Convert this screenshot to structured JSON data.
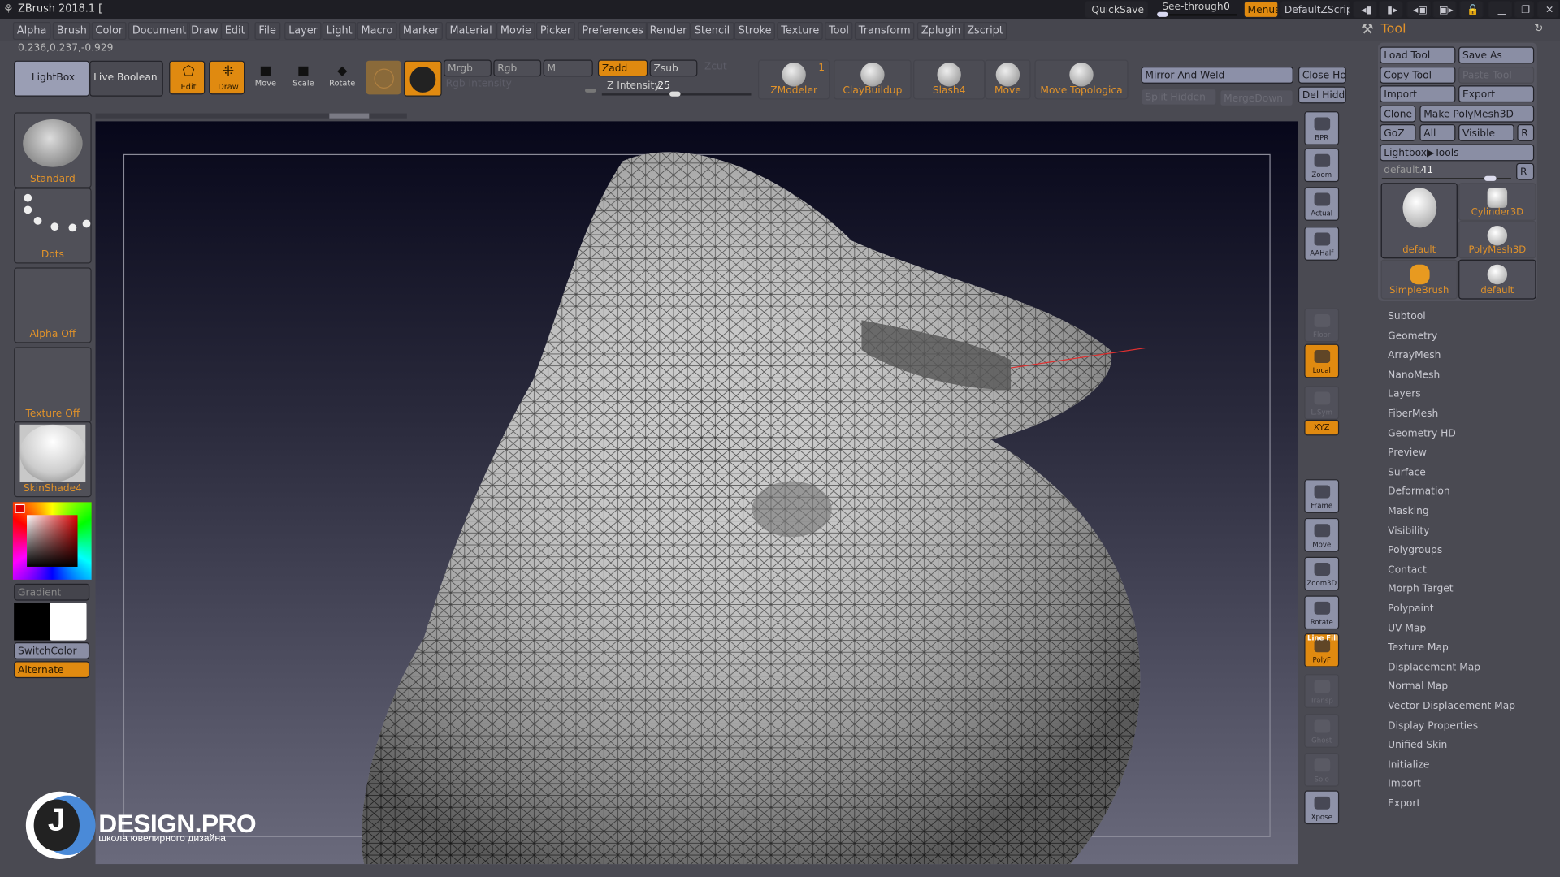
{
  "app": {
    "title": "ZBrush 2018.1 ["
  },
  "titlebar": {
    "quicksave": "QuickSave",
    "see_through_label": "See-through",
    "see_through_value": "0",
    "menus": "Menus",
    "script": "DefaultZScript"
  },
  "menu": [
    "Alpha",
    "Brush",
    "Color",
    "Document",
    "Draw",
    "Edit",
    "File",
    "Layer",
    "Light",
    "Macro",
    "Marker",
    "Material",
    "Movie",
    "Picker",
    "Preferences",
    "Render",
    "Stencil",
    "Stroke",
    "Texture",
    "Tool",
    "Transform",
    "Zplugin",
    "Zscript"
  ],
  "coords": "0.236,0.237,-0.929",
  "toolbar": {
    "lightbox": "LightBox",
    "live_boolean": "Live Boolean",
    "edit": "Edit",
    "draw": "Draw",
    "move": "Move",
    "scale": "Scale",
    "rotate": "Rotate",
    "mrgb": "Mrgb",
    "rgb": "Rgb",
    "m": "M",
    "rgb_intensity": "Rgb Intensity",
    "zadd": "Zadd",
    "zsub": "Zsub",
    "zcut": "Zcut",
    "z_intensity_label": "Z Intensity",
    "z_intensity_value": "25",
    "z_intensity_fraction": 0.25,
    "brushes": [
      {
        "label": "ZModeler",
        "badge": "1"
      },
      {
        "label": "ClayBuildup"
      },
      {
        "label": "Slash4"
      },
      {
        "label": "Move"
      },
      {
        "label": "Move Topologica"
      }
    ],
    "mirror_weld": "Mirror And Weld",
    "split_hidden": "Split Hidden",
    "merge_down": "MergeDown",
    "close_holes": "Close Hol",
    "del_hidden": "Del Hidde"
  },
  "left": {
    "brush": "Standard",
    "stroke": "Dots",
    "alpha": "Alpha Off",
    "texture": "Texture Off",
    "material": "SkinShade4",
    "gradient": "Gradient",
    "switch_color": "SwitchColor",
    "alternate": "Alternate",
    "main_color": "#000000",
    "secondary_color": "#ffffff"
  },
  "right_shelf": [
    {
      "label": "BPR",
      "state": "normal"
    },
    {
      "label": "Zoom",
      "state": "normal"
    },
    {
      "label": "Actual",
      "state": "normal"
    },
    {
      "label": "AAHalf",
      "state": "normal"
    },
    {
      "label": "Floor",
      "state": "off"
    },
    {
      "label": "Local",
      "state": "active"
    },
    {
      "label": "L.Sym",
      "state": "off"
    },
    {
      "label": "XYZ",
      "state": "active"
    },
    {
      "label": "Frame",
      "state": "normal"
    },
    {
      "label": "Move",
      "state": "normal"
    },
    {
      "label": "Zoom3D",
      "state": "normal"
    },
    {
      "label": "Rotate",
      "state": "normal"
    },
    {
      "label": "PolyF",
      "state": "active",
      "sub": "Line Fill"
    },
    {
      "label": "Transp",
      "state": "off"
    },
    {
      "label": "Ghost",
      "state": "off"
    },
    {
      "label": "Solo",
      "state": "off"
    },
    {
      "label": "Xpose",
      "state": "normal"
    }
  ],
  "tool": {
    "title": "Tool",
    "load_tool": "Load Tool",
    "save_as": "Save As",
    "copy_tool": "Copy Tool",
    "paste_tool": "Paste Tool",
    "import": "Import",
    "export": "Export",
    "clone": "Clone",
    "make_polymesh": "Make PolyMesh3D",
    "goz": "GoZ",
    "all": "All",
    "visible": "Visible",
    "r": "R",
    "lightbox_tools": "Lightbox▶Tools",
    "current_name": "default.",
    "current_value": "41",
    "thumbs": [
      "default",
      "Cylinder3D",
      "PolyMesh3D",
      "SimpleBrush",
      "default"
    ],
    "sections": [
      "Subtool",
      "Geometry",
      "ArrayMesh",
      "NanoMesh",
      "Layers",
      "FiberMesh",
      "Geometry HD",
      "Preview",
      "Surface",
      "Deformation",
      "Masking",
      "Visibility",
      "Polygroups",
      "Contact",
      "Morph Target",
      "Polypaint",
      "UV Map",
      "Texture Map",
      "Displacement Map",
      "Normal Map",
      "Vector Displacement Map",
      "Display Properties",
      "Unified Skin",
      "Initialize",
      "Import",
      "Export"
    ]
  },
  "watermark": {
    "brand": "DESIGN.PRO",
    "letter": "J",
    "tagline": "школа ювелирного дизайна"
  },
  "colors": {
    "accent": "#e08a10",
    "panel": "#4a4a52",
    "button": "#8a8ea4"
  }
}
